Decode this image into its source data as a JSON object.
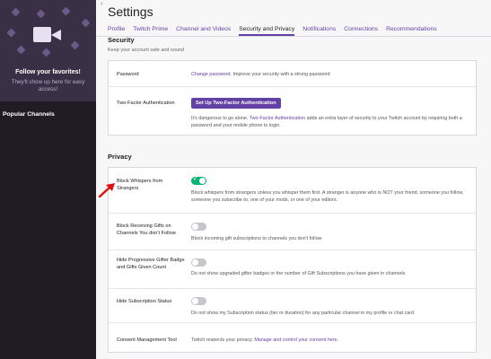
{
  "sidebar": {
    "promo_title": "Follow your favorites!",
    "promo_subtitle": "They'll show up here for easy access!",
    "heading": "Popular Channels"
  },
  "page": {
    "title": "Settings",
    "tabs": [
      {
        "label": "Profile"
      },
      {
        "label": "Twitch Prime"
      },
      {
        "label": "Channel and Videos"
      },
      {
        "label": "Security and Privacy"
      },
      {
        "label": "Notifications"
      },
      {
        "label": "Connections"
      },
      {
        "label": "Recommendations"
      }
    ],
    "active_tab": "Security and Privacy"
  },
  "security": {
    "title": "Security",
    "subtitle": "Keep your account safe and sound",
    "password": {
      "label": "Password",
      "link": "Change password.",
      "text": " Improve your security with a strong password"
    },
    "two_factor": {
      "label": "Two-Factor Authentication",
      "button": "Set Up Two-Factor Authentication",
      "text_before": "It's dangerous to go alone. ",
      "link": "Two-Factor Authentication",
      "text_after": " adds an extra layer of security to your Twitch account by requiring both a password and your mobile phone to login."
    }
  },
  "privacy": {
    "title": "Privacy",
    "rows": [
      {
        "label": "Block Whispers from Strangers",
        "enabled": true,
        "description": "Block whispers from strangers unless you whisper them first. A stranger is anyone who is NOT your friend, someone you follow, someone you subscribe to, one of your mods, or one of your editors."
      },
      {
        "label": "Block Receiving Gifts on Channels You don't Follow",
        "enabled": false,
        "description": "Block incoming gift subscriptions to channels you don't follow"
      },
      {
        "label": "Hide Progressive Gifter Badge and Gifts Given Count",
        "enabled": false,
        "description": "Do not show upgraded gifter badges or the number of Gift Subscriptions you have given in channels"
      },
      {
        "label": "Hide Subscription Status",
        "enabled": false,
        "description": "Do not show my Subscription status (tier or duration) for any particular channel in my profile or chat card"
      }
    ],
    "consent": {
      "label": "Consent Management Tool",
      "text": "Twitch respects your privacy. ",
      "link": "Manage and control your consent here."
    }
  },
  "colors": {
    "accent": "#6441a4",
    "toggle_on": "#00b573",
    "sidebar": "#1f1d23",
    "annotation_arrow": "#e01010"
  }
}
